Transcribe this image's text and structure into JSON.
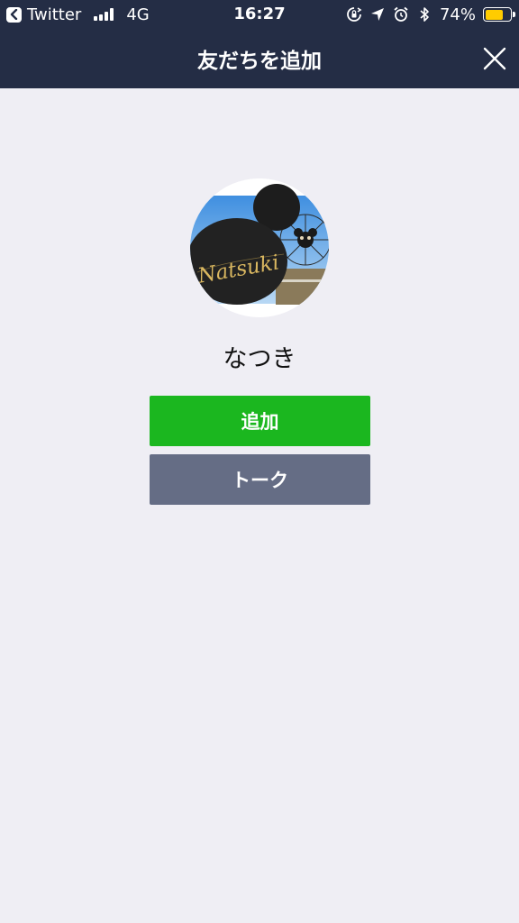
{
  "status_bar": {
    "back_app": "Twitter",
    "network": "4G",
    "time": "16:27",
    "battery_percent": "74%",
    "battery_level": 0.74,
    "battery_color": "#ffcc00",
    "icons": [
      "back-icon",
      "signal-icon",
      "orientation-lock-icon",
      "location-icon",
      "alarm-icon",
      "bluetooth-icon",
      "battery-icon"
    ]
  },
  "nav": {
    "title": "友だちを追加",
    "close_icon": "close-icon",
    "background": "#242d45"
  },
  "profile": {
    "name": "なつき",
    "avatar_text": "Natsuki"
  },
  "actions": {
    "add_label": "追加",
    "add_color": "#1bb71f",
    "talk_label": "トーク",
    "talk_color": "#656d85"
  }
}
